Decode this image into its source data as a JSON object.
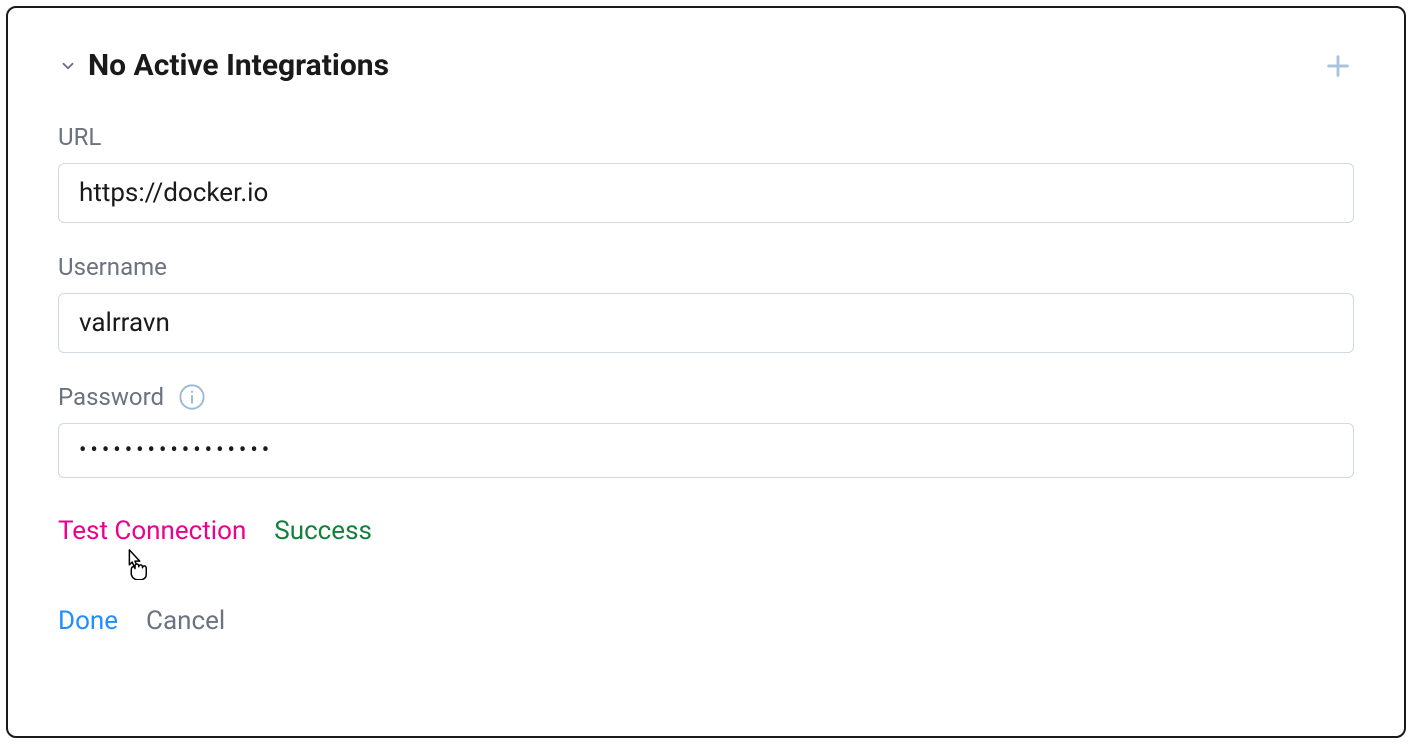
{
  "header": {
    "title": "No Active Integrations"
  },
  "fields": {
    "url": {
      "label": "URL",
      "value": "https://docker.io"
    },
    "username": {
      "label": "Username",
      "value": "valrravn"
    },
    "password": {
      "label": "Password",
      "value": "•••••••••••••••••"
    }
  },
  "actions": {
    "test": "Test Connection",
    "status": "Success",
    "done": "Done",
    "cancel": "Cancel"
  }
}
